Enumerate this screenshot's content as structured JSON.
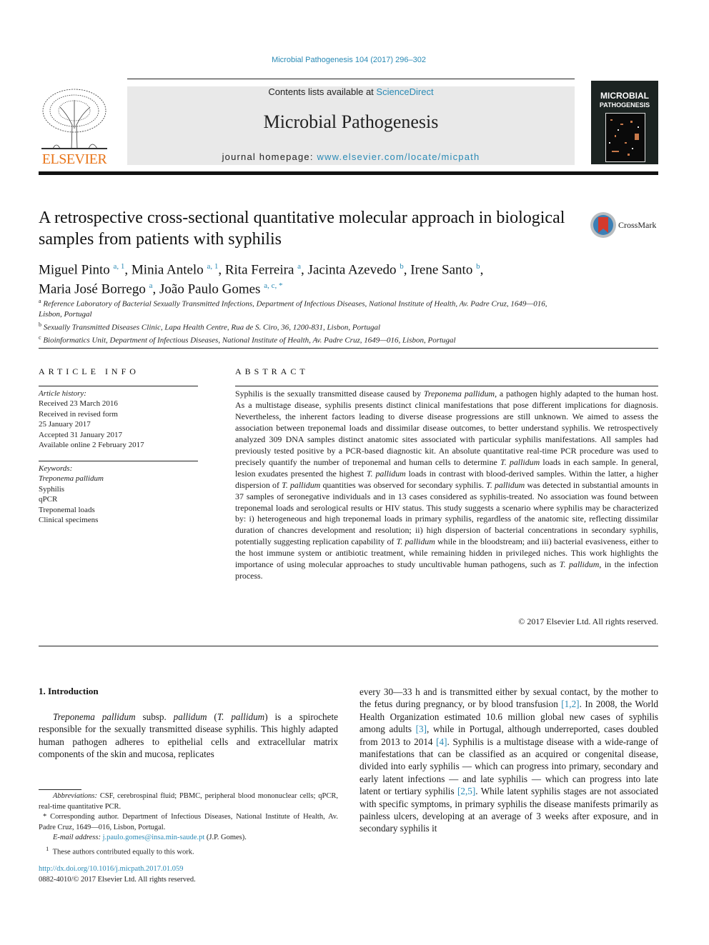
{
  "header": {
    "journal_reference": "Microbial Pathogenesis 104 (2017) 296–302",
    "contents_prefix": "Contents lists available at ",
    "contents_link": "ScienceDirect",
    "journal_title": "Microbial Pathogenesis",
    "homepage_prefix": "journal homepage: ",
    "homepage_link": "www.elsevier.com/locate/micpath",
    "publisher_logo_text": "ELSEVIER",
    "cover_title_line1": "MICROBIAL",
    "cover_title_line2": "PATHOGENESIS"
  },
  "article": {
    "title": "A retrospective cross-sectional quantitative molecular approach in biological samples from patients with syphilis",
    "crossmark_label": "CrossMark",
    "authors": [
      {
        "name": "Miguel Pinto",
        "sup": "a, 1",
        "sep": ", "
      },
      {
        "name": "Minia Antelo",
        "sup": "a, 1",
        "sep": ", "
      },
      {
        "name": "Rita Ferreira",
        "sup": "a",
        "sep": ", "
      },
      {
        "name": "Jacinta Azevedo",
        "sup": "b",
        "sep": ", "
      },
      {
        "name": "Irene Santo",
        "sup": "b",
        "sep": ","
      },
      {
        "name": "Maria José Borrego",
        "sup": "a",
        "sep": ", "
      },
      {
        "name": "João Paulo Gomes",
        "sup": "a, c, *",
        "sep": ""
      }
    ],
    "affiliations": [
      {
        "mark": "a",
        "text": "Reference Laboratory of Bacterial Sexually Transmitted Infections, Department of Infectious Diseases, National Institute of Health, Av. Padre Cruz, 1649—016, Lisbon, Portugal"
      },
      {
        "mark": "b",
        "text": "Sexually Transmitted Diseases Clinic, Lapa Health Centre, Rua de S. Ciro, 36, 1200-831, Lisbon, Portugal"
      },
      {
        "mark": "c",
        "text": "Bioinformatics Unit, Department of Infectious Diseases, National Institute of Health, Av. Padre Cruz, 1649—016, Lisbon, Portugal"
      }
    ]
  },
  "article_info": {
    "heading": "ARTICLE INFO",
    "history_label": "Article history:",
    "history": [
      "Received 23 March 2016",
      "Received in revised form",
      "25 January 2017",
      "Accepted 31 January 2017",
      "Available online 2 February 2017"
    ],
    "keywords_label": "Keywords:",
    "keywords": [
      {
        "text": "Treponema pallidum",
        "italic": true
      },
      {
        "text": "Syphilis",
        "italic": false
      },
      {
        "text": "qPCR",
        "italic": false
      },
      {
        "text": "Treponemal loads",
        "italic": false
      },
      {
        "text": "Clinical specimens",
        "italic": false
      }
    ]
  },
  "abstract": {
    "heading": "ABSTRACT",
    "segments": [
      {
        "t": "Syphilis is the sexually transmitted disease caused by ",
        "i": false
      },
      {
        "t": "Treponema pallidum",
        "i": true
      },
      {
        "t": ", a pathogen highly adapted to the human host. As a multistage disease, syphilis presents distinct clinical manifestations that pose different implications for diagnosis. Nevertheless, the inherent factors leading to diverse disease pro­gressions are still unknown. We aimed to assess the association between treponemal loads and dis­similar disease outcomes, to better understand syphilis. We retrospectively analyzed 309 DNA samples distinct anatomic sites associated with particular syphilis manifestations. All samples had previously tested positive by a PCR-based diagnostic kit. An absolute quantitative real-time PCR procedure was used to precisely quantify the number of treponemal and human cells to determine ",
        "i": false
      },
      {
        "t": "T. pallidum",
        "i": true
      },
      {
        "t": " loads in each sample. In general, lesion exudates presented the highest ",
        "i": false
      },
      {
        "t": "T. pallidum",
        "i": true
      },
      {
        "t": " loads in contrast with blood-derived samples. Within the latter, a higher dispersion of ",
        "i": false
      },
      {
        "t": "T. pallidum",
        "i": true
      },
      {
        "t": " quantities was observed for sec­ondary syphilis. ",
        "i": false
      },
      {
        "t": "T. pallidum",
        "i": true
      },
      {
        "t": " was detected in substantial amounts in 37 samples of seronegative in­dividuals and in 13 cases considered as syphilis-treated. No association was found between treponemal loads and serological results or HIV status. This study suggests a scenario where syphilis may be char­acterized by: i) heterogeneous and high treponemal loads in primary syphilis, regardless of the anatomic site, reflecting dissimilar duration of chancres development and resolution; ii) high dispersion of bac­terial concentrations in secondary syphilis, potentially suggesting replication capability of ",
        "i": false
      },
      {
        "t": "T. pallidum",
        "i": true
      },
      {
        "t": " while in the bloodstream; and iii) bacterial evasiveness, either to the host immune system or antibiotic treatment, while remaining hidden in privileged niches. This work highlights the importance of using molecular approaches to study uncultivable human pathogens, such as ",
        "i": false
      },
      {
        "t": "T. pallidum",
        "i": true
      },
      {
        "t": ", in the infection process.",
        "i": false
      }
    ],
    "copyright": "© 2017 Elsevier Ltd. All rights reserved."
  },
  "introduction": {
    "heading": "1.  Introduction",
    "left_segments": [
      {
        "t": "Treponema pallidum",
        "i": true,
        "l": false
      },
      {
        "t": " subsp. ",
        "i": false,
        "l": false
      },
      {
        "t": "pallidum",
        "i": true,
        "l": false
      },
      {
        "t": " (",
        "i": false,
        "l": false
      },
      {
        "t": "T. pallidum",
        "i": true,
        "l": false
      },
      {
        "t": ") is a spirochete responsible for the sexually transmitted disease syphilis. This highly adapted human pathogen adheres to epithelial cells and extracellular matrix components of the skin and mucosa, replicates",
        "i": false,
        "l": false
      }
    ],
    "right_segments": [
      {
        "t": "every 30—33 h and is transmitted either by sexual contact, by the mother to the fetus during pregnancy, or by blood transfusion ",
        "i": false,
        "l": false
      },
      {
        "t": "[1,2]",
        "i": false,
        "l": true
      },
      {
        "t": ". In 2008, the World Health Organization estimated 10.6 million global new cases of syphilis among adults ",
        "i": false,
        "l": false
      },
      {
        "t": "[3]",
        "i": false,
        "l": true
      },
      {
        "t": ", while in Portugal, although underreported, cases doubled from 2013 to 2014 ",
        "i": false,
        "l": false
      },
      {
        "t": "[4]",
        "i": false,
        "l": true
      },
      {
        "t": ". Syphilis is a multistage disease with a wide-range of manifestations that can be classified as an acquired or congenital disease, divided into early syphilis — which can progress into primary, secondary and early latent infections — and late syphilis — which can progress into late latent or tertiary syphilis ",
        "i": false,
        "l": false
      },
      {
        "t": "[2,5]",
        "i": false,
        "l": true
      },
      {
        "t": ". While latent syphilis stages are not associated with specific symptoms, in primary syphilis the disease manifests primarily as painless ulcers, developing at an average of 3 weeks after exposure, and in secondary syphilis it",
        "i": false,
        "l": false
      }
    ]
  },
  "footnotes": {
    "abbrev_label": "Abbreviations:",
    "abbrev_text": " CSF, cerebrospinal fluid; PBMC, peripheral blood mononuclear cells; qPCR, real-time quantitative PCR.",
    "corresponding": "* Corresponding author. Department of Infectious Diseases, National Institute of Health, Av. Padre Cruz, 1649—016, Lisbon, Portugal.",
    "email_label": "E-mail address:",
    "email": "j.paulo.gomes@insa.min-saude.pt",
    "email_suffix": " (J.P. Gomes).",
    "equal_mark": "1",
    "equal_text": "These authors contributed equally to this work.",
    "doi": "http://dx.doi.org/10.1016/j.micpath.2017.01.059",
    "issn": "0882-4010/© 2017 Elsevier Ltd. All rights reserved."
  }
}
